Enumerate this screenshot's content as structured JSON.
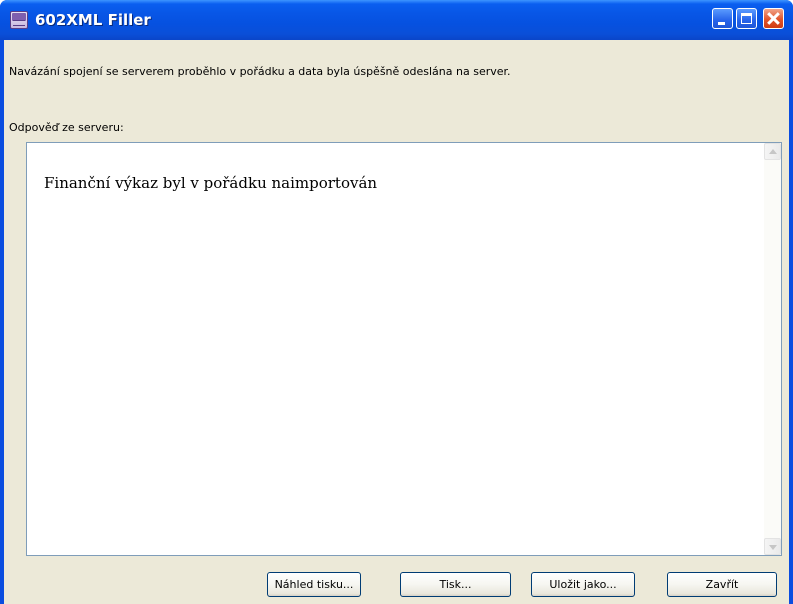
{
  "window": {
    "title": "602XML Filler",
    "icon": "602xml-app-icon",
    "controls": {
      "minimize": "minimize-icon",
      "maximize": "maximize-icon",
      "close": "close-icon"
    }
  },
  "dialog": {
    "message": "Navázání spojení se serverem proběhlo v pořádku a data byla úspěšně odeslána na server.",
    "response_label": "Odpověď ze serveru:",
    "response_text": "Finanční výkaz byl v pořádku naimportován"
  },
  "buttons": {
    "print_preview": "Náhled tisku...",
    "print": "Tisk...",
    "save_as": "Uložit jako...",
    "close": "Zavřít"
  },
  "colors": {
    "titlebar": "#0a5ef0",
    "dialog_background": "#ece9d8",
    "close_button": "#e2542a"
  }
}
